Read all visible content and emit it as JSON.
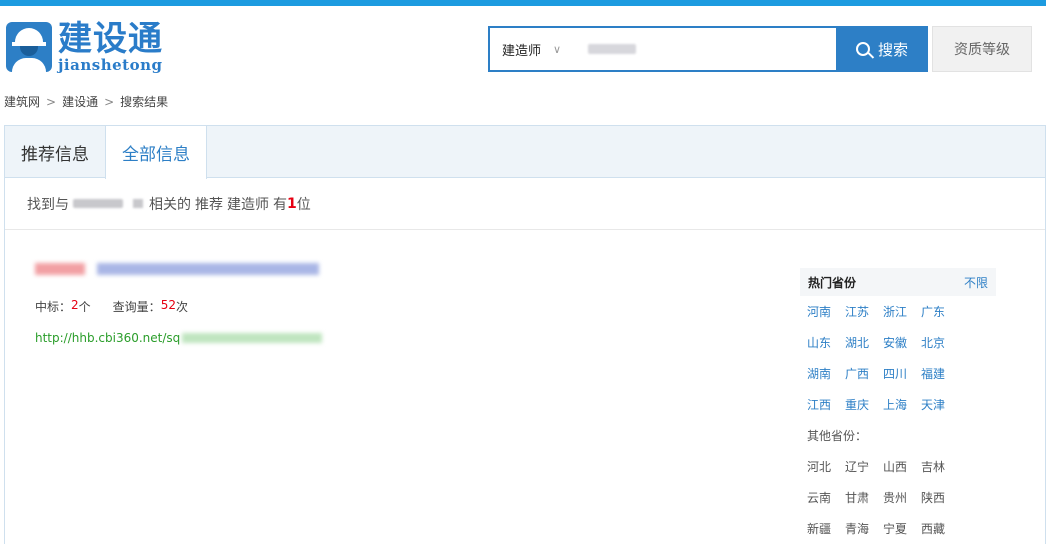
{
  "logo": {
    "cn": "建设通",
    "en": "jianshetong"
  },
  "search": {
    "category": "建造师",
    "button_label": "搜索"
  },
  "grade_button": "资质等级",
  "breadcrumb": [
    "建筑网",
    "建设通",
    "搜索结果"
  ],
  "tabs": [
    "推荐信息",
    "全部信息"
  ],
  "found": {
    "prefix": "找到与",
    "mid": "相关的",
    "type": "推荐",
    "category": "建造师",
    "has": "有",
    "count": "1",
    "unit": "位"
  },
  "result": {
    "bid_label": "中标：",
    "bid_value": "2",
    "bid_unit": "个",
    "query_label": "查询量：",
    "query_value": "52",
    "query_unit": "次",
    "url": "http://hhb.cbi360.net/sq"
  },
  "provinces": {
    "title": "热门省份",
    "all": "不限",
    "hot": [
      [
        "河南",
        "江苏",
        "浙江",
        "广东"
      ],
      [
        "山东",
        "湖北",
        "安徽",
        "北京"
      ],
      [
        "湖南",
        "广西",
        "四川",
        "福建"
      ],
      [
        "江西",
        "重庆",
        "上海",
        "天津"
      ]
    ],
    "other_label": "其他省份：",
    "other": [
      [
        "河北",
        "辽宁",
        "山西",
        "吉林"
      ],
      [
        "云南",
        "甘肃",
        "贵州",
        "陕西"
      ],
      [
        "新疆",
        "青海",
        "宁夏",
        "西藏"
      ]
    ]
  }
}
